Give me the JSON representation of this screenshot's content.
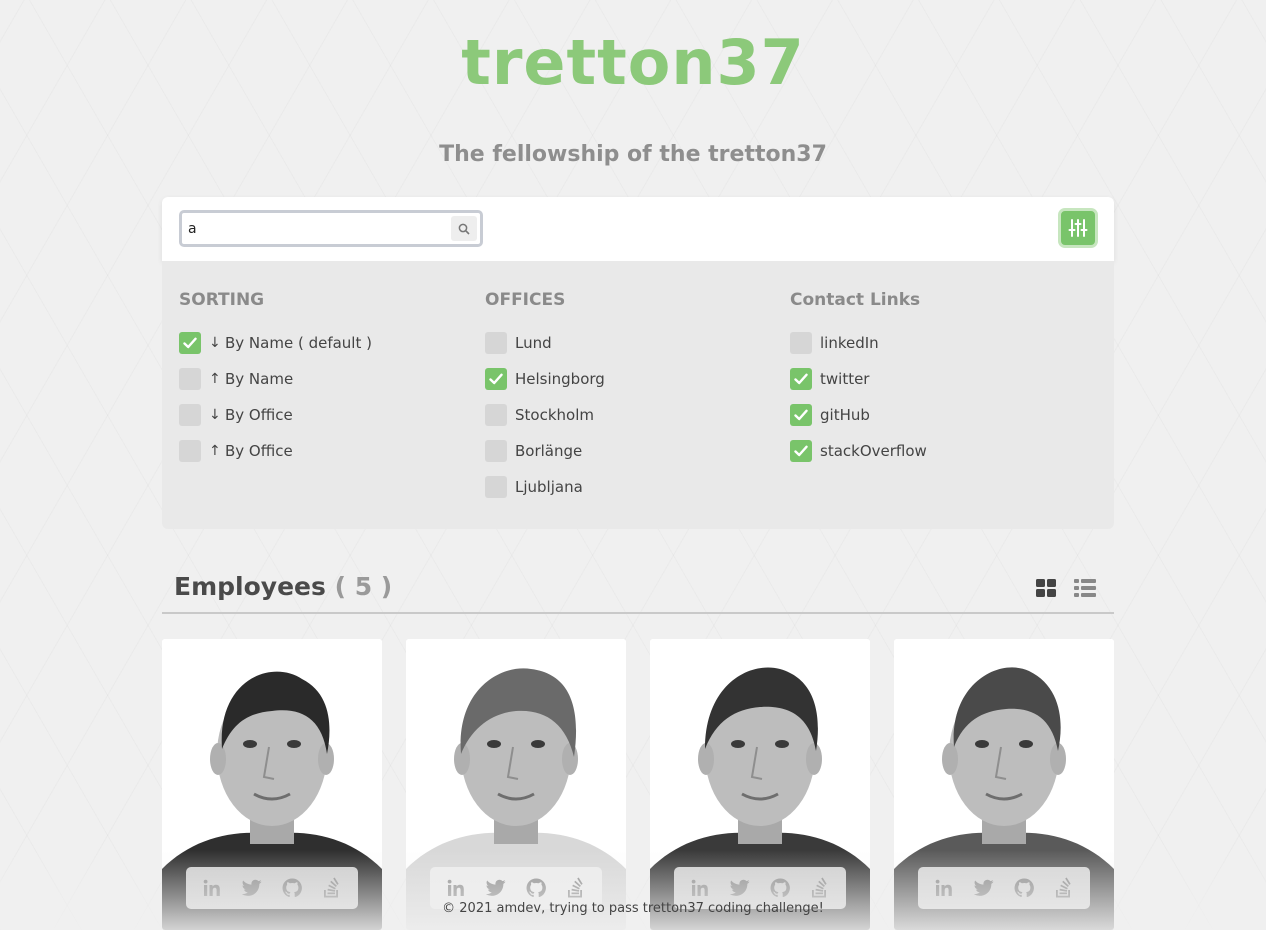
{
  "brand": {
    "logo_text": "tretton37",
    "accent": "#8cc97a",
    "filter_accent": "#79c46a"
  },
  "subtitle": "The fellowship of the tretton37",
  "search": {
    "value": "a",
    "icon": "search-icon"
  },
  "filter_toggle": {
    "icon": "sliders-icon",
    "active": true
  },
  "sorting": {
    "title": "SORTING",
    "options": [
      {
        "arrow": "↓",
        "label": "By Name ( default )",
        "checked": true
      },
      {
        "arrow": "↑",
        "label": "By Name",
        "checked": false
      },
      {
        "arrow": "↓",
        "label": "By Office",
        "checked": false
      },
      {
        "arrow": "↑",
        "label": "By Office",
        "checked": false
      }
    ]
  },
  "offices": {
    "title": "OFFICES",
    "options": [
      {
        "label": "Lund",
        "checked": false
      },
      {
        "label": "Helsingborg",
        "checked": true
      },
      {
        "label": "Stockholm",
        "checked": false
      },
      {
        "label": "Borlänge",
        "checked": false
      },
      {
        "label": "Ljubljana",
        "checked": false
      }
    ]
  },
  "contact_links": {
    "title": "Contact Links",
    "options": [
      {
        "label": "linkedIn",
        "checked": false
      },
      {
        "label": "twitter",
        "checked": true
      },
      {
        "label": "gitHub",
        "checked": true
      },
      {
        "label": "stackOverflow",
        "checked": true
      }
    ]
  },
  "employees": {
    "title": "Employees",
    "count_text": "( 5 )",
    "view_icons": [
      "grid-view-icon",
      "list-view-icon"
    ],
    "cards": [
      {
        "photo": "portrait-photo",
        "socials": [
          "linkedin-icon",
          "twitter-icon",
          "github-icon",
          "stackoverflow-icon"
        ]
      },
      {
        "photo": "portrait-photo",
        "socials": [
          "linkedin-icon",
          "twitter-icon",
          "github-icon",
          "stackoverflow-icon"
        ]
      },
      {
        "photo": "portrait-photo",
        "socials": [
          "linkedin-icon",
          "twitter-icon",
          "github-icon",
          "stackoverflow-icon"
        ]
      },
      {
        "photo": "portrait-photo",
        "socials": [
          "linkedin-icon",
          "twitter-icon",
          "github-icon",
          "stackoverflow-icon"
        ]
      }
    ]
  },
  "footer": "© 2021 amdev, trying to pass tretton37 coding challenge!"
}
